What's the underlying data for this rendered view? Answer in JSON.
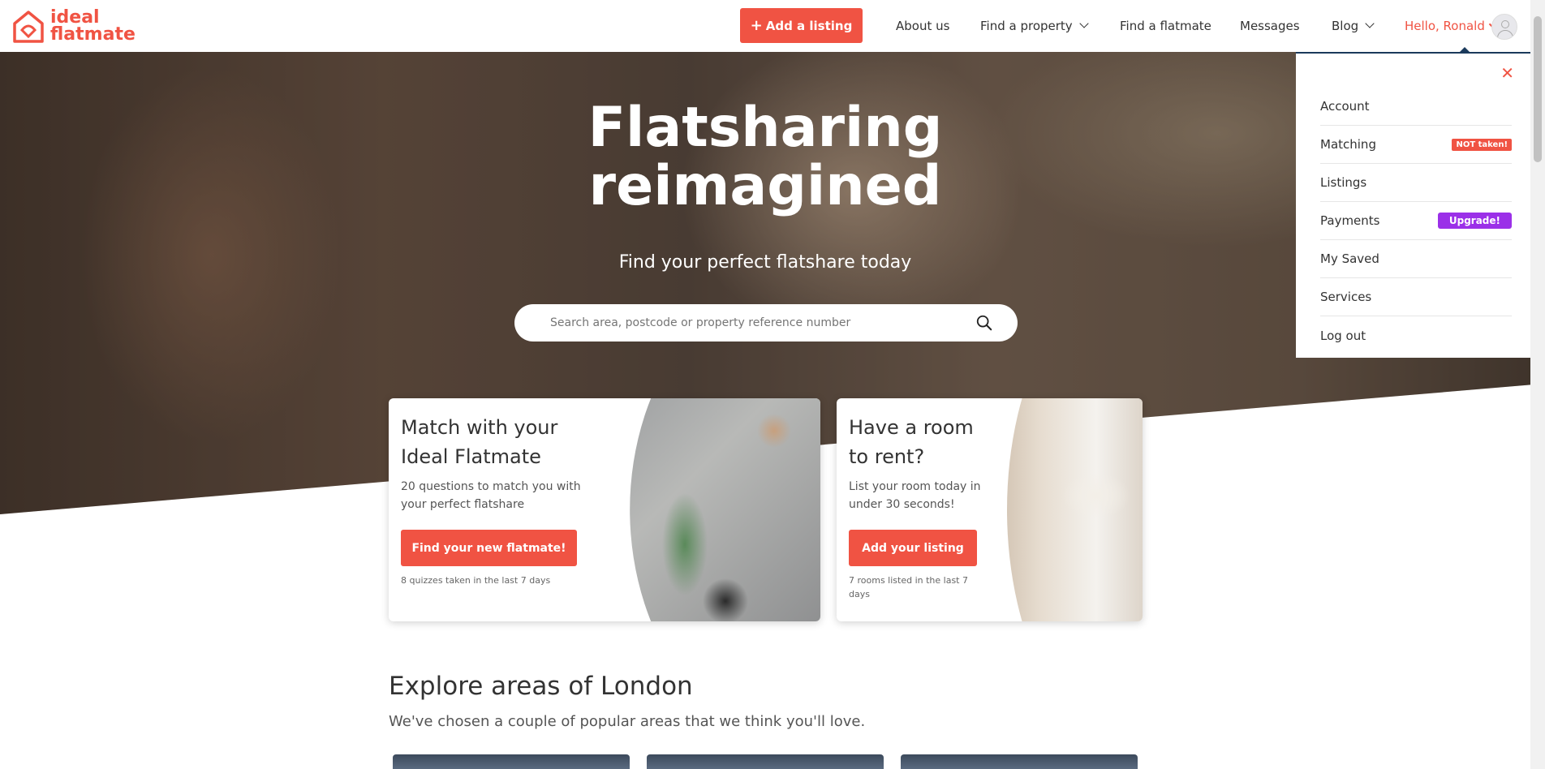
{
  "header": {
    "logo_line1": "ideal",
    "logo_line2": "flatmate",
    "add_listing": "Add a listing",
    "nav": {
      "about": "About us",
      "find_property": "Find a property",
      "find_flatmate": "Find a flatmate",
      "messages": "Messages",
      "blog": "Blog"
    },
    "greeting": "Hello, Ronald"
  },
  "hero": {
    "title_line1": "Flatsharing",
    "title_line2": "reimagined",
    "subtitle": "Find your perfect flatshare today",
    "search_placeholder": "Search area, postcode or property reference number"
  },
  "cards": {
    "match": {
      "title_line1": "Match with your",
      "title_line2": "Ideal Flatmate",
      "text_line1": "20 questions to match you with",
      "text_line2": "your perfect flatshare",
      "button": "Find your new flatmate!",
      "footer": "8 quizzes taken in the last 7 days"
    },
    "room": {
      "title_line1": "Have a room",
      "title_line2": "to rent?",
      "text_line1": "List your room today in",
      "text_line2": "under 30 seconds!",
      "button": "Add your listing",
      "footer_line1": "7 rooms listed in the last 7",
      "footer_line2": "days"
    }
  },
  "explore": {
    "title": "Explore areas of London",
    "subtitle": "We've chosen a couple of popular areas that we think you'll love."
  },
  "dropdown": {
    "close": "✕",
    "items": [
      {
        "label": "Account",
        "badge": ""
      },
      {
        "label": "Matching",
        "badge": "NOT taken!"
      },
      {
        "label": "Listings",
        "badge": ""
      },
      {
        "label": "Payments",
        "badge": "Upgrade!"
      },
      {
        "label": "My Saved",
        "badge": ""
      },
      {
        "label": "Services",
        "badge": ""
      },
      {
        "label": "Log out",
        "badge": ""
      }
    ]
  },
  "colors": {
    "brand": "#f05343",
    "upgrade": "#9b30e8",
    "dropdown_border": "#1b3a5c"
  }
}
